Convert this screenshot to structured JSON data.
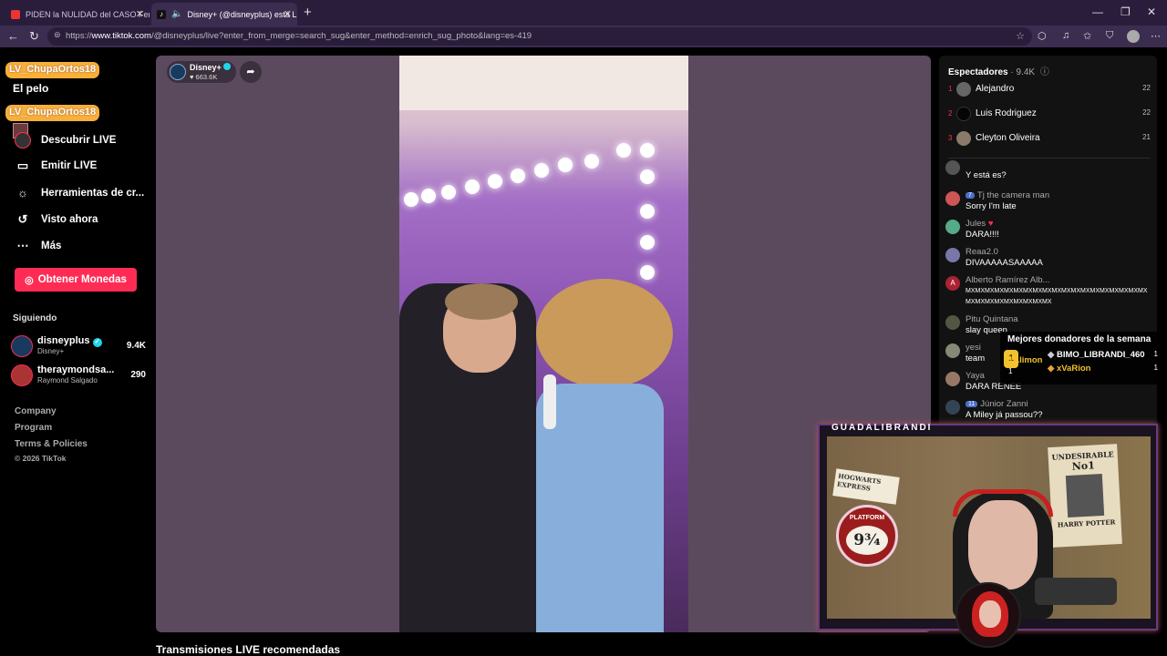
{
  "browser": {
    "tabs": [
      {
        "label": "PIDEN la NULIDAD del CASO Fem",
        "active": false
      },
      {
        "label": "Disney+ (@disneyplus) está L",
        "active": true
      }
    ],
    "url_prefix": "https://",
    "url_host": "www.tiktok.com",
    "url_path": "/@disneyplus/live?enter_from_merge=search_sug&enter_method=enrich_sug_photo&lang=es-419"
  },
  "overlay": {
    "badge1": "LV_ChupaOrtos18",
    "badge2": "LV_ChupaOrtos18",
    "partial_text": "El pelo"
  },
  "sidebar": {
    "items": [
      {
        "label": "Descubrir LIVE",
        "icon": "live-avatar"
      },
      {
        "label": "Emitir LIVE",
        "icon": "video-camera-icon"
      },
      {
        "label": "Herramientas de cr...",
        "icon": "lightbulb-icon"
      },
      {
        "label": "Visto ahora",
        "icon": "history-icon"
      },
      {
        "label": "Más",
        "icon": "more-icon"
      }
    ],
    "coins_button": "Obtener Monedas",
    "following_label": "Siguiendo",
    "following": [
      {
        "name": "disneyplus",
        "sub": "Disney+",
        "count": "9.4K",
        "verified": true
      },
      {
        "name": "theraymondsa...",
        "sub": "Raymond Salgado",
        "count": "290",
        "verified": false
      }
    ],
    "footer": [
      "Company",
      "Program",
      "Terms & Policies",
      "© 2026 TikTok"
    ]
  },
  "live": {
    "host_name": "Disney+",
    "host_likes": "663.6K",
    "recommended_title": "Transmisiones LIVE recomendadas"
  },
  "viewers": {
    "title": "Espectadores",
    "count": "9.4K",
    "top": [
      {
        "rank": "1",
        "name": "Alejandro",
        "score": "22"
      },
      {
        "rank": "2",
        "name": "Luis Rodriguez",
        "score": "22"
      },
      {
        "rank": "3",
        "name": "Cleyton Oliveira",
        "score": "21"
      }
    ]
  },
  "chat": [
    {
      "name": "",
      "level": "",
      "text": "Y está es?"
    },
    {
      "name": "Tj the camera man",
      "level": "7",
      "text": "Sorry I'm late"
    },
    {
      "name": "Jules",
      "level": "",
      "text": "DARA!!!!"
    },
    {
      "name": "Reaa2.0",
      "level": "",
      "text": "DIVAAAAASAAAAA"
    },
    {
      "name": "Alberto Ramírez Alb...",
      "level": "",
      "text": "MXMXMXMXMXMXMXMXMXMXMXMXMXMXMXMXMXMXMX",
      "text2": "MXMXMXMXMXMXMXMXMX"
    },
    {
      "name": "Pitu Quintana",
      "level": "",
      "text": "slay queen"
    },
    {
      "name": "yesi",
      "level": "",
      "text": "team"
    },
    {
      "name": "Yaya",
      "level": "",
      "text": "DARA RENEE"
    },
    {
      "name": "Júnior Zanni",
      "level": "11",
      "text": "A Miley já passou??"
    }
  ],
  "donors": {
    "title": "Mejores donadores de la semana",
    "rank1": "1Alimon",
    "rank1_count": "1",
    "others": [
      {
        "name": "BIMO_LIBRANDI_460",
        "count": "1"
      },
      {
        "name": "xVaRion",
        "count": "1"
      }
    ]
  },
  "webcam": {
    "streamer": "GUADALIBRANDI",
    "poster_title": "UNDESIRABLE",
    "poster_no": "No1",
    "poster_name": "HARRY POTTER",
    "sign_top": "HOGWARTS EXPRESS",
    "sign_platform": "PLATFORM",
    "sign_num": "9¾"
  },
  "colors": {
    "accent": "#fe2c55",
    "badge": "#f7b03a"
  }
}
